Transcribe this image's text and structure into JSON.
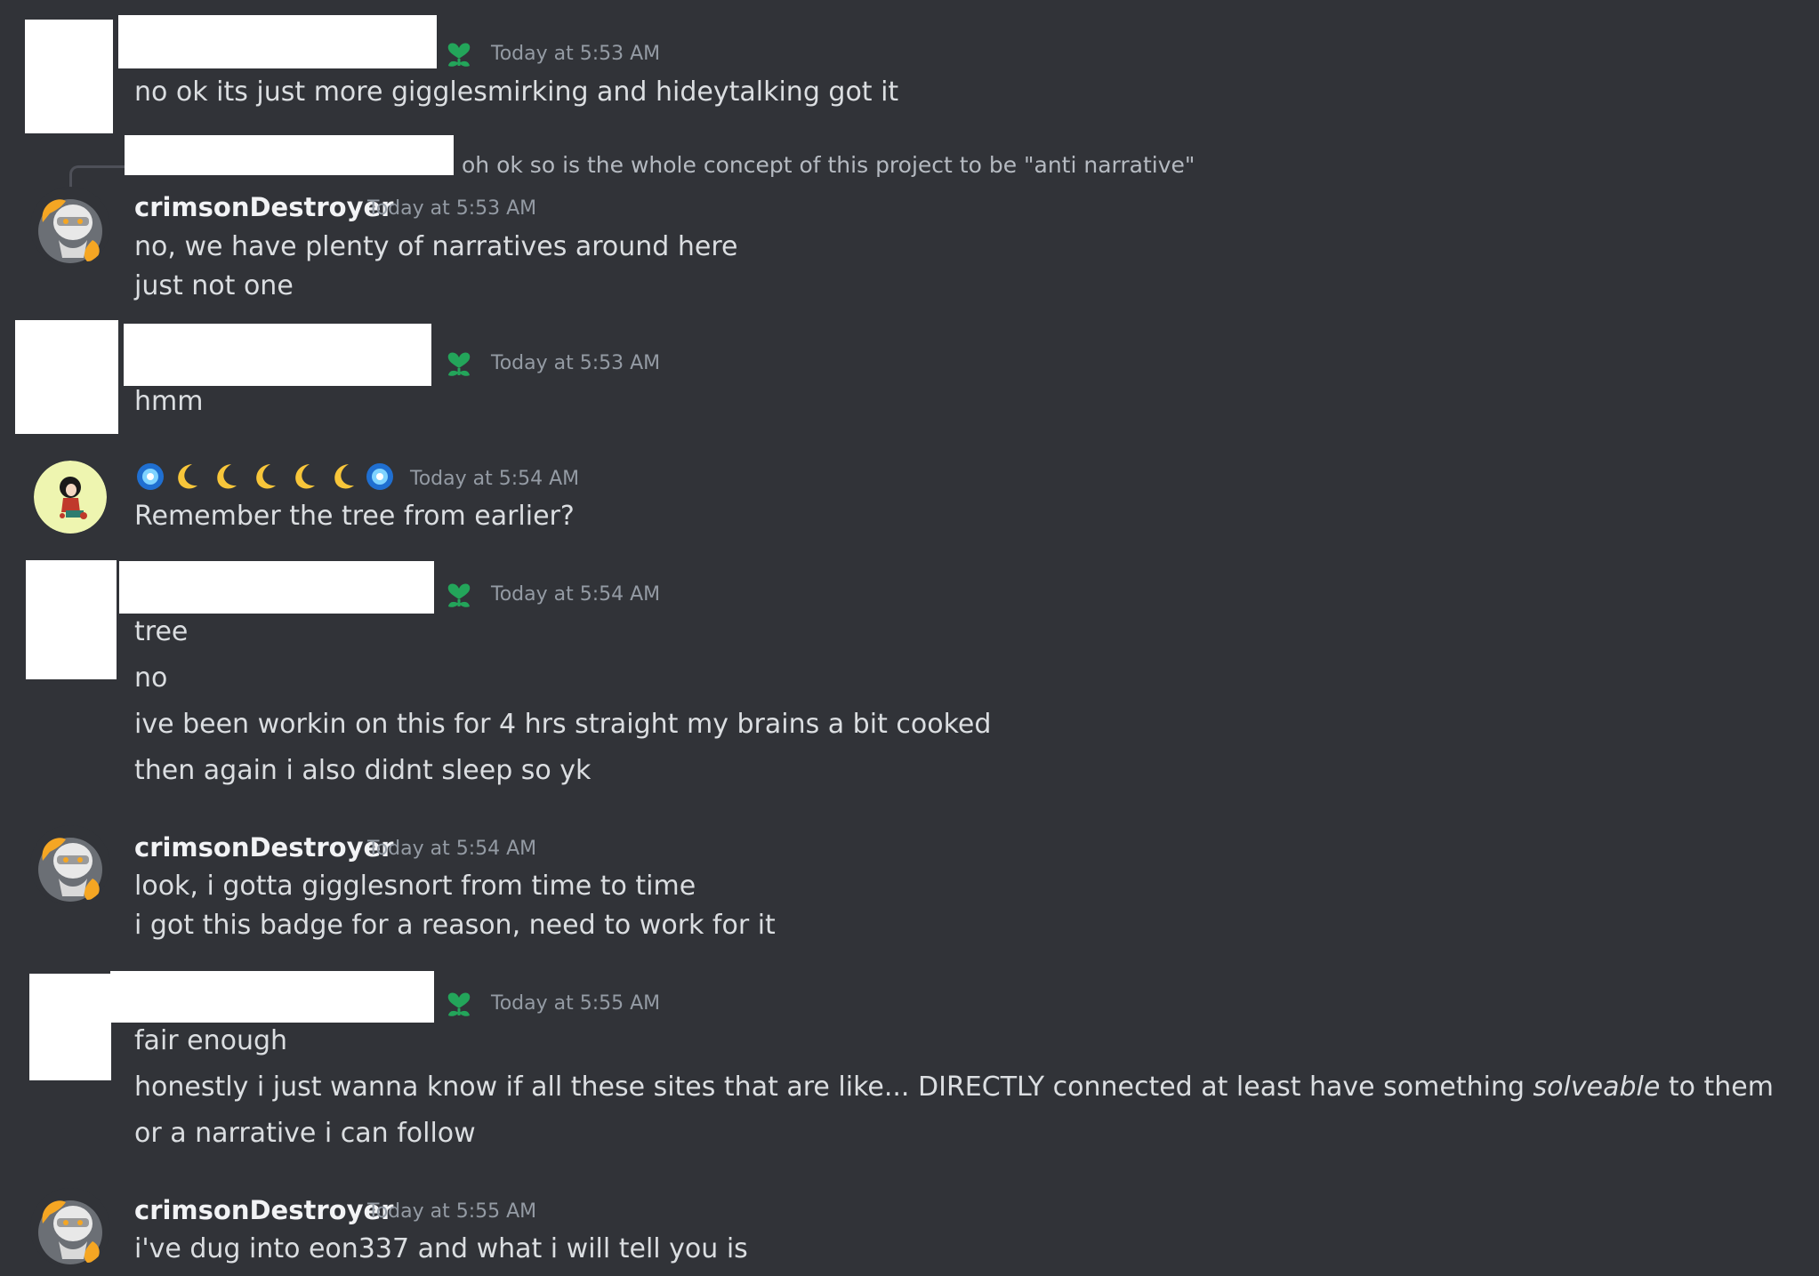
{
  "messages": [
    {
      "timestamp": "Today at 5:53 AM",
      "lines": [
        "no ok its just more gigglesmirking and hideytalking got it"
      ]
    },
    {
      "reply_preview": "oh ok so is the whole concept of this project to be \"anti narrative\"",
      "username": "crimsonDestroyer",
      "timestamp": "Today at 5:53 AM",
      "lines": [
        "no, we have plenty of narratives around here",
        "just not one"
      ]
    },
    {
      "timestamp": "Today at 5:53 AM",
      "lines": [
        "hmm"
      ]
    },
    {
      "timestamp": "Today at 5:54 AM",
      "lines": [
        "Remember the tree from earlier?"
      ]
    },
    {
      "timestamp": "Today at 5:54 AM",
      "lines": [
        "tree",
        "no",
        "ive been workin on this for 4 hrs straight my brains a bit cooked",
        "then again i also didnt sleep so yk"
      ]
    },
    {
      "username": "crimsonDestroyer",
      "timestamp": "Today at 5:54 AM",
      "lines": [
        "look, i gotta gigglesnort from time to time",
        "i got this badge for a reason, need to work for it"
      ]
    },
    {
      "timestamp": "Today at 5:55 AM",
      "lines": [
        "fair enough"
      ],
      "line2_pre": "honestly i just wanna know if all these sites that are like... DIRECTLY connected at least have something ",
      "line2_em": "solveable",
      "line2_post": " to them",
      "line3": "or a narrative i can follow"
    },
    {
      "username": "crimsonDestroyer",
      "timestamp": "Today at 5:55 AM",
      "lines": [
        "i've dug into eon337 and what i will tell you is"
      ]
    }
  ],
  "icons": {
    "role": "green-heart-sprout-icon",
    "name_decoration": [
      "blue-orb-icon",
      "crescent-moon-icon",
      "crescent-moon-icon",
      "crescent-moon-icon",
      "crescent-moon-icon",
      "crescent-moon-icon",
      "blue-orb-icon"
    ]
  },
  "colors": {
    "background": "#313338",
    "username": "#f2f3f5",
    "timestamp": "#949ba4",
    "message_text": "#dbdee1",
    "role_icon": "#23a55a"
  }
}
